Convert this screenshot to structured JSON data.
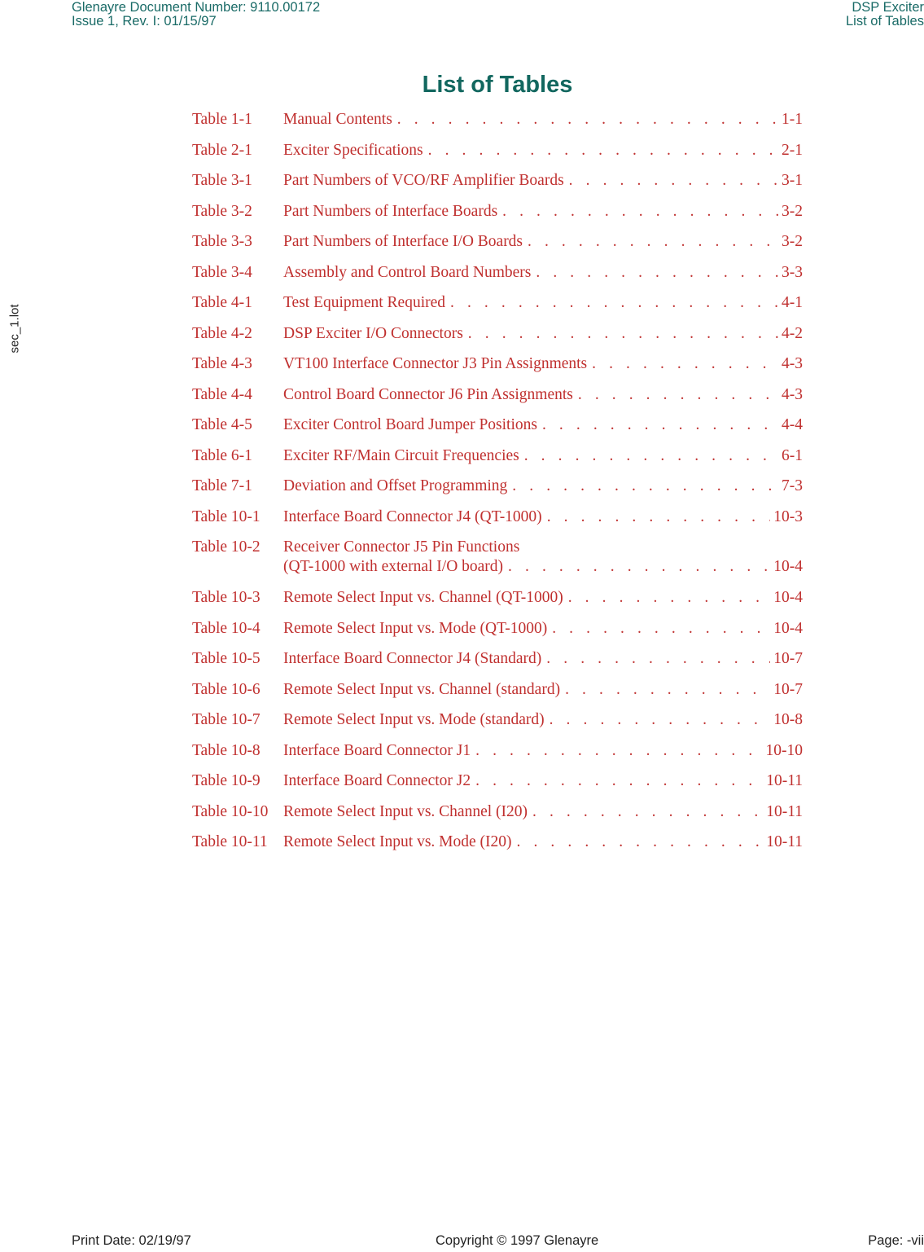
{
  "header": {
    "left_line1": "Glenayre Document Number: 9110.00172",
    "left_line2": "Issue 1, Rev. I: 01/15/97",
    "right_line1": "DSP Exciter",
    "right_line2": "List of Tables"
  },
  "side_label": "sec_1.lot",
  "title": "List of Tables",
  "entries": [
    {
      "number": "Table 1-1",
      "lines": [
        "Manual Contents"
      ],
      "page": "1-1"
    },
    {
      "number": "Table 2-1",
      "lines": [
        "Exciter Specifications"
      ],
      "page": "2-1"
    },
    {
      "number": "Table 3-1",
      "lines": [
        "Part Numbers of VCO/RF Amplifier Boards"
      ],
      "page": "3-1"
    },
    {
      "number": "Table 3-2",
      "lines": [
        "Part Numbers of Interface Boards"
      ],
      "page": "3-2"
    },
    {
      "number": "Table 3-3",
      "lines": [
        "Part Numbers of Interface I/O Boards"
      ],
      "page": "3-2"
    },
    {
      "number": "Table 3-4",
      "lines": [
        "Assembly and Control Board Numbers"
      ],
      "page": "3-3"
    },
    {
      "number": "Table 4-1",
      "lines": [
        "Test Equipment Required"
      ],
      "page": "4-1"
    },
    {
      "number": "Table 4-2",
      "lines": [
        "DSP Exciter I/O Connectors"
      ],
      "page": "4-2"
    },
    {
      "number": "Table 4-3",
      "lines": [
        "VT100 Interface Connector J3 Pin Assignments"
      ],
      "page": "4-3"
    },
    {
      "number": "Table 4-4",
      "lines": [
        "Control Board Connector J6 Pin Assignments"
      ],
      "page": "4-3"
    },
    {
      "number": "Table 4-5",
      "lines": [
        "Exciter Control Board Jumper Positions"
      ],
      "page": "4-4"
    },
    {
      "number": "Table 6-1",
      "lines": [
        "Exciter RF/Main Circuit Frequencies"
      ],
      "page": "6-1"
    },
    {
      "number": "Table 7-1",
      "lines": [
        "Deviation and Offset Programming"
      ],
      "page": "7-3"
    },
    {
      "number": "Table 10-1",
      "lines": [
        "Interface Board Connector J4 (QT-1000)"
      ],
      "page": "10-3"
    },
    {
      "number": "Table 10-2",
      "lines": [
        "Receiver Connector J5 Pin Functions",
        "(QT-1000 with external I/O board)"
      ],
      "page": "10-4"
    },
    {
      "number": "Table 10-3",
      "lines": [
        "Remote Select Input vs. Channel (QT-1000)"
      ],
      "page": "10-4"
    },
    {
      "number": "Table 10-4",
      "lines": [
        "Remote Select Input vs. Mode (QT-1000)"
      ],
      "page": "10-4"
    },
    {
      "number": "Table 10-5",
      "lines": [
        "Interface Board Connector J4 (Standard)"
      ],
      "page": "10-7"
    },
    {
      "number": "Table 10-6",
      "lines": [
        "Remote Select Input vs. Channel (standard)"
      ],
      "page": "10-7"
    },
    {
      "number": "Table 10-7",
      "lines": [
        "Remote Select Input vs. Mode (standard)"
      ],
      "page": "10-8"
    },
    {
      "number": "Table 10-8",
      "lines": [
        "Interface Board Connector J1"
      ],
      "page": "10-10"
    },
    {
      "number": "Table 10-9",
      "lines": [
        "Interface Board Connector J2"
      ],
      "page": "10-11"
    },
    {
      "number": "Table 10-10",
      "lines": [
        "Remote Select Input vs. Channel (I20)"
      ],
      "page": "10-11"
    },
    {
      "number": "Table 10-11",
      "lines": [
        "Remote Select Input vs. Mode (I20)"
      ],
      "page": "10-11"
    }
  ],
  "footer": {
    "print_date": "Print Date: 02/19/97",
    "copyright": "Copyright © 1997 Glenayre",
    "page": "Page: -vii"
  },
  "colors": {
    "header_teal": "#1a6b67",
    "title_teal": "#12675f",
    "entry_red": "#c0302f"
  }
}
